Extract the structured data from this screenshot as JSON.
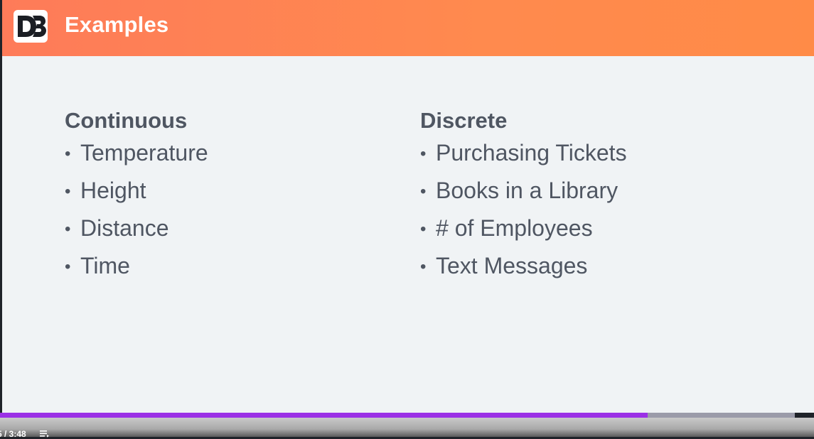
{
  "header": {
    "title": "Examples",
    "logo_icon": "d3-logo-icon"
  },
  "columns": [
    {
      "heading": "Continuous",
      "items": [
        "Temperature",
        "Height",
        "Distance",
        "Time"
      ]
    },
    {
      "heading": "Discrete",
      "items": [
        "Purchasing Tickets",
        "Books in a Library",
        "# of Employees",
        "Text Messages"
      ]
    }
  ],
  "bullet": "•",
  "player": {
    "time_text": "5 / 3:48",
    "progress_fraction": 0.815,
    "progress_color": "#9b30e6",
    "chapters_icon": "chapters-list-icon"
  },
  "colors": {
    "header_start": "#fe7b59",
    "header_end": "#ff8b47",
    "slide_background": "#f0f3f5",
    "text": "#4f5662"
  }
}
